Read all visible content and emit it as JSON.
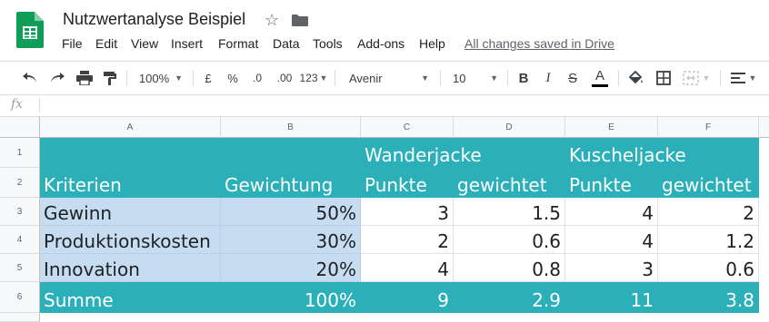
{
  "doc": {
    "title": "Nutzwertanalyse Beispiel"
  },
  "menu": [
    "File",
    "Edit",
    "View",
    "Insert",
    "Format",
    "Data",
    "Tools",
    "Add-ons",
    "Help"
  ],
  "save_status": "All changes saved in Drive",
  "toolbar": {
    "zoom": "100%",
    "currency": "£",
    "percent": "%",
    "decrease_decimal": ".0",
    "increase_decimal": ".00",
    "more_formats": "123",
    "font": "Avenir",
    "font_size": "10",
    "bold": "B",
    "italic": "I",
    "strikethrough": "S",
    "text_color": "A"
  },
  "formula_bar": {
    "label": "fx",
    "value": ""
  },
  "columns": [
    "A",
    "B",
    "C",
    "D",
    "E",
    "F"
  ],
  "rows": [
    "1",
    "2",
    "3",
    "4",
    "5",
    "6"
  ],
  "sheet": {
    "r1": {
      "c": "Wanderjacke",
      "e": "Kuscheljacke"
    },
    "r2": {
      "a": "Kriterien",
      "b": "Gewichtung",
      "c": "Punkte",
      "d": "gewichtet",
      "e": "Punkte",
      "f": "gewichtet"
    },
    "r3": {
      "a": "Gewinn",
      "b": "50%",
      "c": "3",
      "d": "1.5",
      "e": "4",
      "f": "2"
    },
    "r4": {
      "a": "Produktionskosten",
      "b": "30%",
      "c": "2",
      "d": "0.6",
      "e": "4",
      "f": "1.2"
    },
    "r5": {
      "a": "Innovation",
      "b": "20%",
      "c": "4",
      "d": "0.8",
      "e": "3",
      "f": "0.6"
    },
    "r6": {
      "a": "Summe",
      "b": "100%",
      "c": "9",
      "d": "2.9",
      "e": "11",
      "f": "3.8"
    }
  },
  "colors": {
    "teal": "#2bb0b9",
    "light_blue": "#c6dcf0",
    "logo_green": "#0f9d58"
  }
}
